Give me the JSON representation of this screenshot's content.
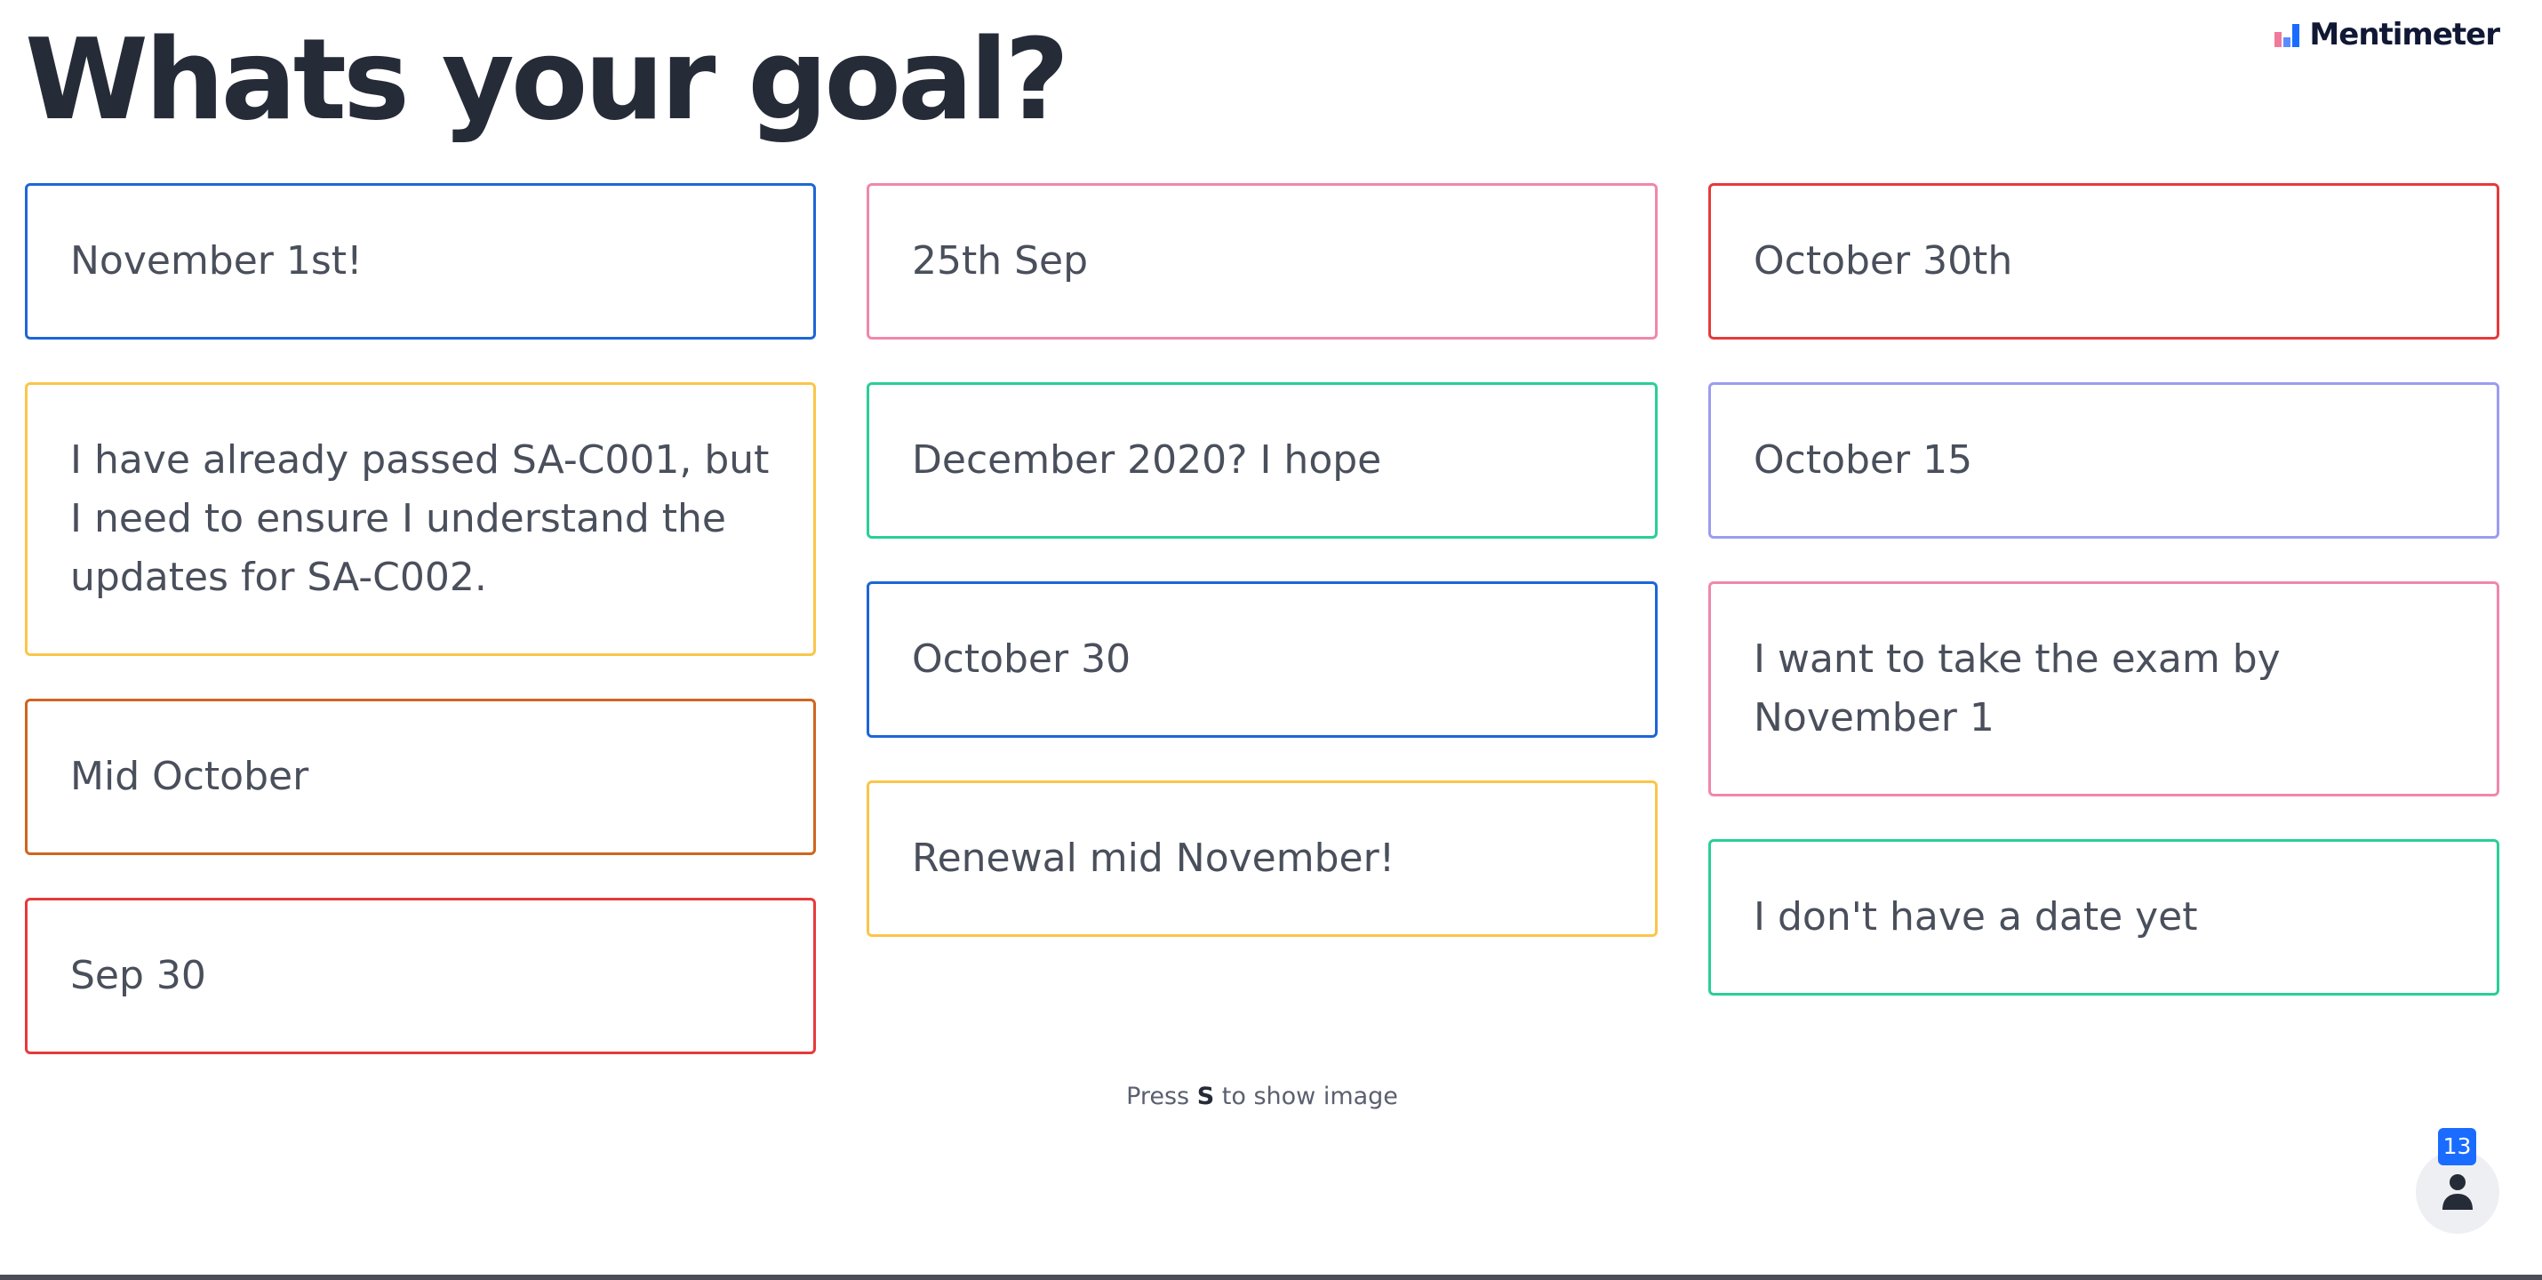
{
  "slide": {
    "question": "Whats your goal?",
    "brand": "Mentimeter"
  },
  "columns": [
    [
      {
        "text": "November 1st!",
        "color": "#1d66d6"
      },
      {
        "text": "I have already passed SA-C001, but I need to ensure I understand the updates for SA-C002.",
        "color": "#fbc54a"
      },
      {
        "text": "Mid October",
        "color": "#d0651f"
      },
      {
        "text": "Sep 30",
        "color": "#e63a3a"
      }
    ],
    [
      {
        "text": "25th Sep",
        "color": "#f087ad"
      },
      {
        "text": "December 2020? I hope",
        "color": "#29cf95"
      },
      {
        "text": "October 30",
        "color": "#1d66d6"
      },
      {
        "text": "Renewal mid November!",
        "color": "#fbc54a"
      }
    ],
    [
      {
        "text": "October 30th",
        "color": "#e63a3a"
      },
      {
        "text": "October 15",
        "color": "#9c9cf0"
      },
      {
        "text": "I want to take the exam by November 1",
        "color": "#f087ad"
      },
      {
        "text": "I don't have a date yet",
        "color": "#29cf95"
      }
    ]
  ],
  "hint": {
    "prefix": "Press",
    "key": "S",
    "suffix": "to show image"
  },
  "audience": {
    "count": "13",
    "icon": "person-icon"
  },
  "colors": {
    "accent": "#196cff",
    "title": "#262b38",
    "card_text": "#4a4f5c"
  }
}
